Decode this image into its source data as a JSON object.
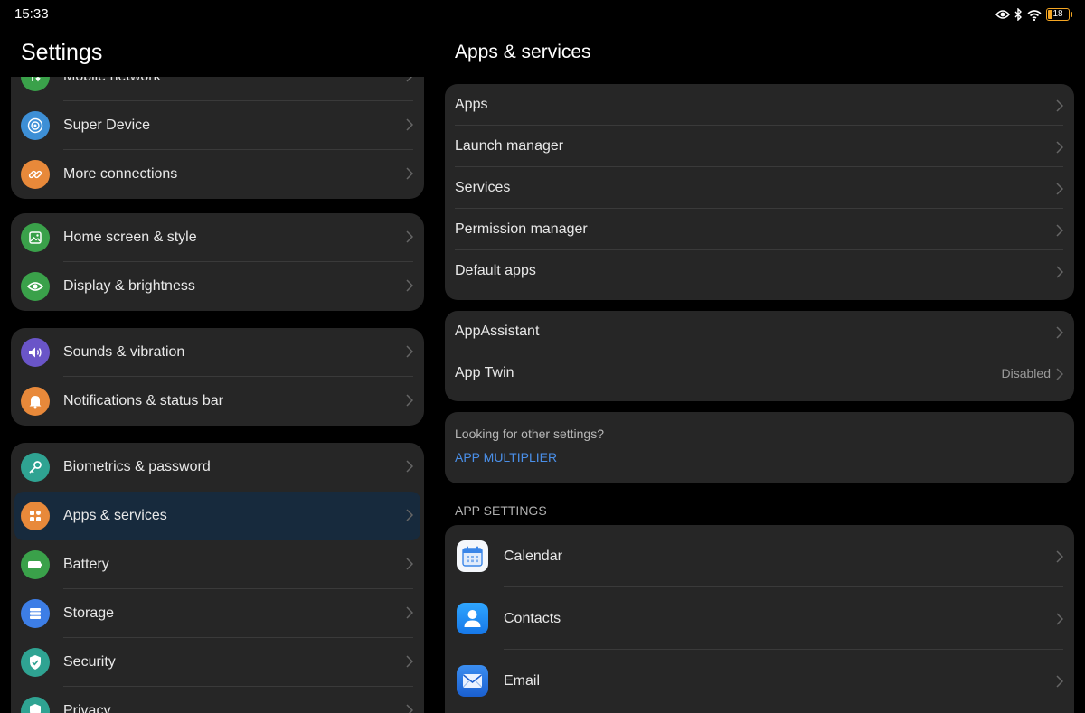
{
  "status_bar": {
    "time": "15:33",
    "battery_level": "18",
    "icons": [
      "eye-comfort-icon",
      "bluetooth-icon",
      "wifi-icon",
      "battery-icon"
    ]
  },
  "left": {
    "title": "Settings",
    "groups": [
      {
        "items": [
          {
            "label": "Mobile network",
            "icon": "mobile-network-icon",
            "color": "#3aa14a"
          },
          {
            "label": "Super Device",
            "icon": "super-device-icon",
            "color": "#3d8fd6"
          },
          {
            "label": "More connections",
            "icon": "link-icon",
            "color": "#e8893a"
          }
        ]
      },
      {
        "items": [
          {
            "label": "Home screen & style",
            "icon": "home-screen-icon",
            "color": "#3aa14a"
          },
          {
            "label": "Display & brightness",
            "icon": "eye-icon",
            "color": "#3aa14a"
          }
        ]
      },
      {
        "items": [
          {
            "label": "Sounds & vibration",
            "icon": "speaker-icon",
            "color": "#6a55c8"
          },
          {
            "label": "Notifications & status bar",
            "icon": "bell-icon",
            "color": "#e8893a"
          }
        ]
      },
      {
        "items": [
          {
            "label": "Biometrics & password",
            "icon": "key-icon",
            "color": "#2fa392"
          },
          {
            "label": "Apps & services",
            "icon": "apps-icon",
            "color": "#e8893a",
            "selected": true
          },
          {
            "label": "Battery",
            "icon": "battery-icon",
            "color": "#3aa14a"
          },
          {
            "label": "Storage",
            "icon": "storage-icon",
            "color": "#3d7ee6"
          },
          {
            "label": "Security",
            "icon": "shield-icon",
            "color": "#2fa392"
          },
          {
            "label": "Privacy",
            "icon": "privacy-icon",
            "color": "#2fa392"
          }
        ]
      }
    ]
  },
  "right": {
    "title": "Apps & services",
    "group1": [
      "Apps",
      "Launch manager",
      "Services",
      "Permission manager",
      "Default apps"
    ],
    "group2": [
      {
        "label": "AppAssistant",
        "value": ""
      },
      {
        "label": "App Twin",
        "value": "Disabled"
      }
    ],
    "hint": {
      "question": "Looking for other settings?",
      "link": "APP MULTIPLIER"
    },
    "section_header": "APP SETTINGS",
    "app_settings": [
      {
        "label": "Calendar",
        "icon": "calendar-icon"
      },
      {
        "label": "Contacts",
        "icon": "contacts-icon"
      },
      {
        "label": "Email",
        "icon": "email-icon"
      }
    ]
  }
}
